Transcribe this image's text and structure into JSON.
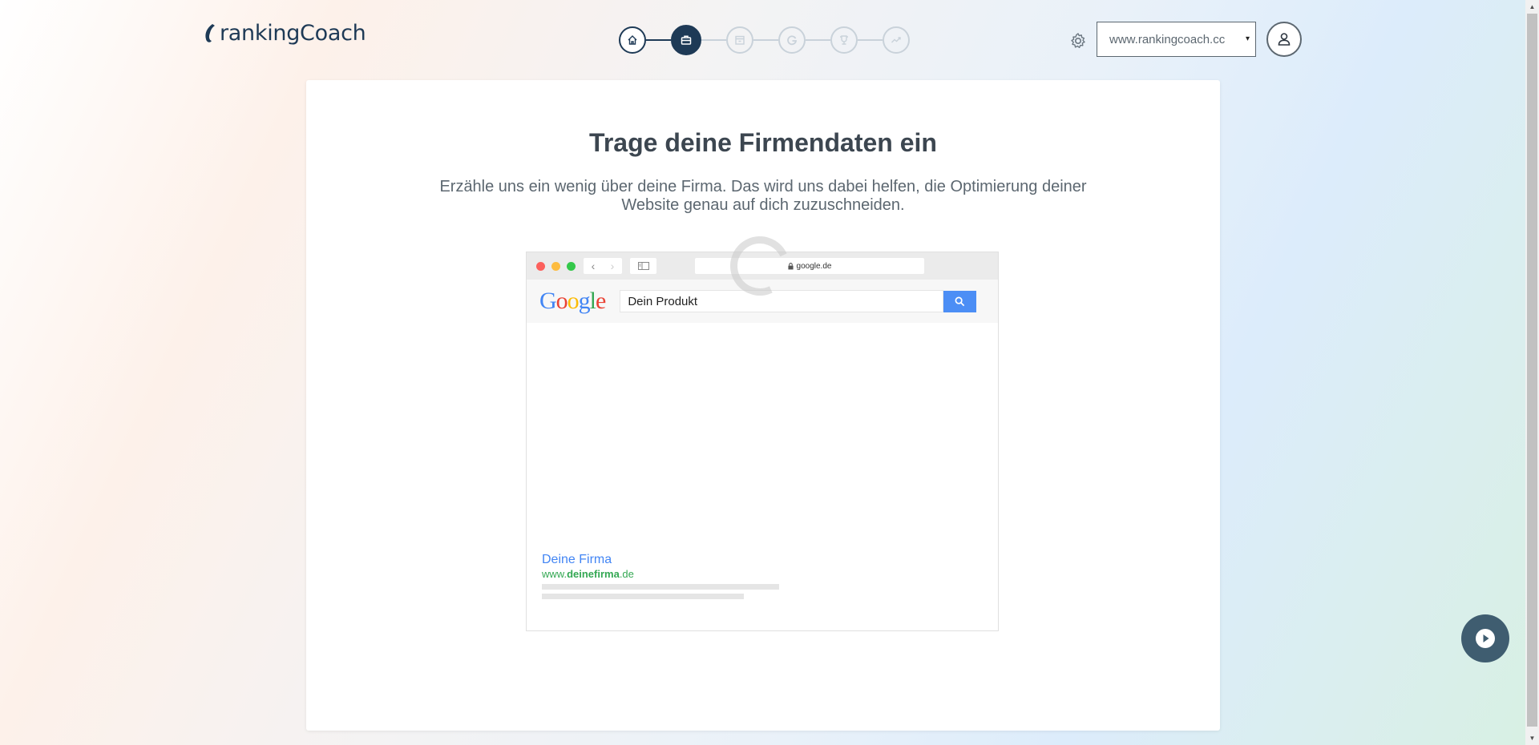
{
  "header": {
    "logo_text": "rankingCoach",
    "steps": [
      {
        "icon": "home-icon",
        "state": "done"
      },
      {
        "icon": "briefcase-icon",
        "state": "active"
      },
      {
        "icon": "calendar-icon",
        "state": "pending"
      },
      {
        "icon": "google-icon",
        "state": "pending"
      },
      {
        "icon": "trophy-icon",
        "state": "pending"
      },
      {
        "icon": "trend-icon",
        "state": "pending"
      }
    ],
    "site_select_value": "www.rankingcoach.cc",
    "caret": "▾"
  },
  "main": {
    "title": "Trage deine Firmendaten ein",
    "subtitle": "Erzähle uns ein wenig über deine Firma. Das wird uns dabei helfen, die Optimierung deiner Website genau auf dich zuzuschneiden."
  },
  "browser_mock": {
    "url": "google.de",
    "search_query": "Dein Produkt",
    "google_logo": [
      "G",
      "o",
      "o",
      "g",
      "l",
      "e"
    ],
    "result": {
      "title": "Deine Firma",
      "url_prefix": "www.",
      "url_bold": "deinefirma",
      "url_suffix": ".de"
    }
  },
  "colors": {
    "brand_dark": "#1e3a56",
    "step_inactive": "#c9d2da",
    "google_blue": "#4285f4",
    "google_red": "#ea4335",
    "google_yellow": "#fbbc05",
    "google_green": "#34a853",
    "play_button": "#3f5d70"
  }
}
